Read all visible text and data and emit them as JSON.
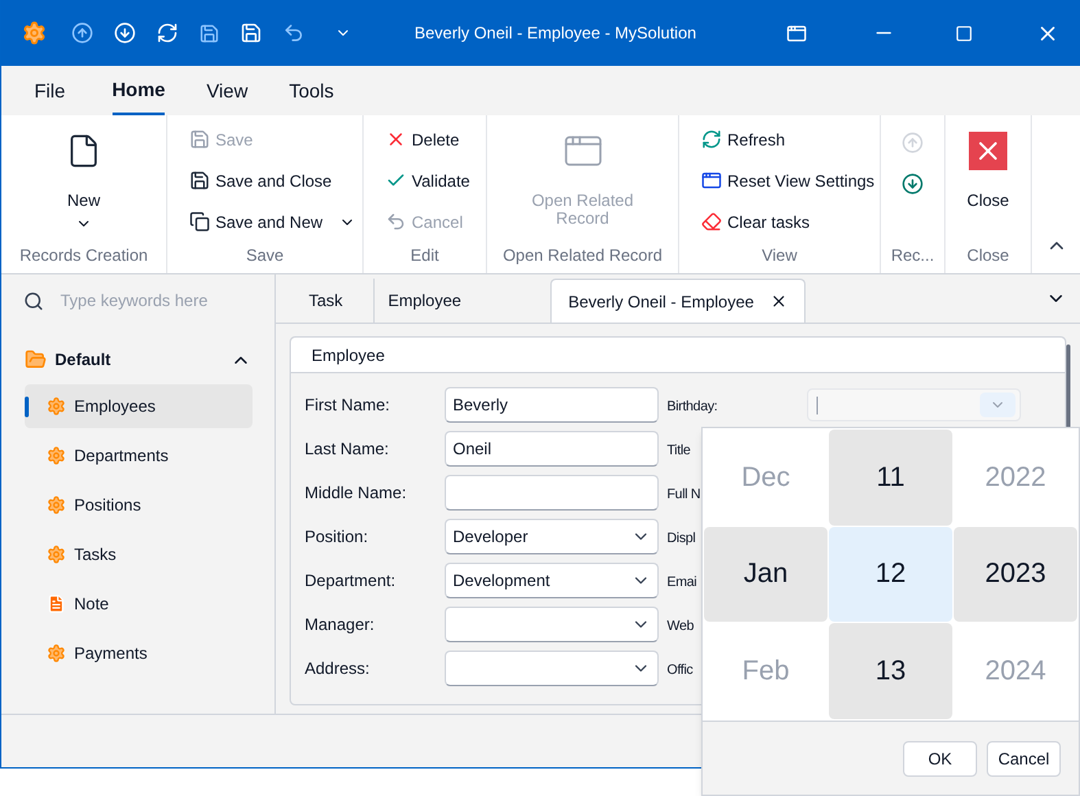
{
  "window": {
    "title": "Beverly Oneil - Employee - MySolution"
  },
  "menu_tabs": [
    {
      "label": "File",
      "selected": false
    },
    {
      "label": "Home",
      "selected": true
    },
    {
      "label": "View",
      "selected": false
    },
    {
      "label": "Tools",
      "selected": false
    }
  ],
  "ribbon": {
    "groups": [
      {
        "caption": "Records Creation",
        "items": [
          {
            "kind": "large",
            "label": "New",
            "disabled": false,
            "dropdown": true
          }
        ]
      },
      {
        "caption": "Save",
        "items": [
          {
            "kind": "small",
            "label": "Save",
            "disabled": true,
            "dropdown": false
          },
          {
            "kind": "small",
            "label": "Save and Close",
            "disabled": false,
            "dropdown": false
          },
          {
            "kind": "small",
            "label": "Save and New",
            "disabled": false,
            "dropdown": true
          }
        ]
      },
      {
        "caption": "Edit",
        "items": [
          {
            "kind": "small",
            "label": "Delete",
            "disabled": false,
            "dropdown": false
          },
          {
            "kind": "small",
            "label": "Validate",
            "disabled": false,
            "dropdown": false
          },
          {
            "kind": "small",
            "label": "Cancel",
            "disabled": true,
            "dropdown": false
          }
        ]
      },
      {
        "caption": "Open Related Record",
        "items": [
          {
            "kind": "large",
            "label": "Open Related Record",
            "disabled": true,
            "dropdown": false
          }
        ]
      },
      {
        "caption": "View",
        "items": [
          {
            "kind": "small",
            "label": "Refresh",
            "disabled": false,
            "dropdown": false
          },
          {
            "kind": "small",
            "label": "Reset View Settings",
            "disabled": false,
            "dropdown": false
          },
          {
            "kind": "small",
            "label": "Clear tasks",
            "disabled": false,
            "dropdown": false
          }
        ]
      },
      {
        "caption": "Rec...",
        "items": [
          {
            "kind": "icon",
            "disabled": true
          },
          {
            "kind": "icon",
            "disabled": false
          }
        ]
      },
      {
        "caption": "Close",
        "items": [
          {
            "kind": "large",
            "label": "Close",
            "disabled": false,
            "dropdown": false
          }
        ]
      }
    ]
  },
  "sidebar": {
    "search": {
      "placeholder": "Type keywords here"
    },
    "group": {
      "label": "Default",
      "expanded": true,
      "items": [
        {
          "label": "Employees",
          "selected": true,
          "kind": "gear"
        },
        {
          "label": "Departments",
          "selected": false,
          "kind": "gear"
        },
        {
          "label": "Positions",
          "selected": false,
          "kind": "gear"
        },
        {
          "label": "Tasks",
          "selected": false,
          "kind": "gear"
        },
        {
          "label": "Note",
          "selected": false,
          "kind": "note"
        },
        {
          "label": "Payments",
          "selected": false,
          "kind": "gear"
        }
      ]
    }
  },
  "doc_tabs": [
    {
      "label": "Task",
      "selected": false,
      "closable": false
    },
    {
      "label": "Employee",
      "selected": false,
      "closable": false
    },
    {
      "label": "Beverly Oneil - Employee",
      "selected": true,
      "closable": true
    }
  ],
  "form": {
    "section": "Employee",
    "left_fields": [
      {
        "label": "First Name:",
        "value": "Beverly",
        "kind": "text"
      },
      {
        "label": "Last Name:",
        "value": "Oneil",
        "kind": "text"
      },
      {
        "label": "Middle Name:",
        "kind": "text"
      },
      {
        "label": "Position:",
        "value": "Developer",
        "kind": "combo"
      },
      {
        "label": "Department:",
        "value": "Development",
        "kind": "combo"
      },
      {
        "label": "Manager:",
        "kind": "combo"
      },
      {
        "label": "Address:",
        "kind": "combo"
      }
    ],
    "right_labels": [
      "Birthday:",
      "Title",
      "Full N",
      "Displ",
      "Emai",
      "Web",
      "Offic"
    ]
  },
  "date_picker": {
    "columns": [
      {
        "focused": false,
        "items": [
          {
            "label": "Dec",
            "selected": false
          },
          {
            "label": "Jan",
            "selected": true
          },
          {
            "label": "Feb",
            "selected": false
          }
        ]
      },
      {
        "focused": true,
        "items": [
          {
            "label": "11",
            "selected": false
          },
          {
            "label": "12",
            "selected": true
          },
          {
            "label": "13",
            "selected": false
          }
        ]
      },
      {
        "focused": false,
        "items": [
          {
            "label": "2022",
            "selected": false
          },
          {
            "label": "2023",
            "selected": true
          },
          {
            "label": "2024",
            "selected": false
          }
        ]
      }
    ],
    "buttons": [
      "OK",
      "Cancel"
    ]
  }
}
